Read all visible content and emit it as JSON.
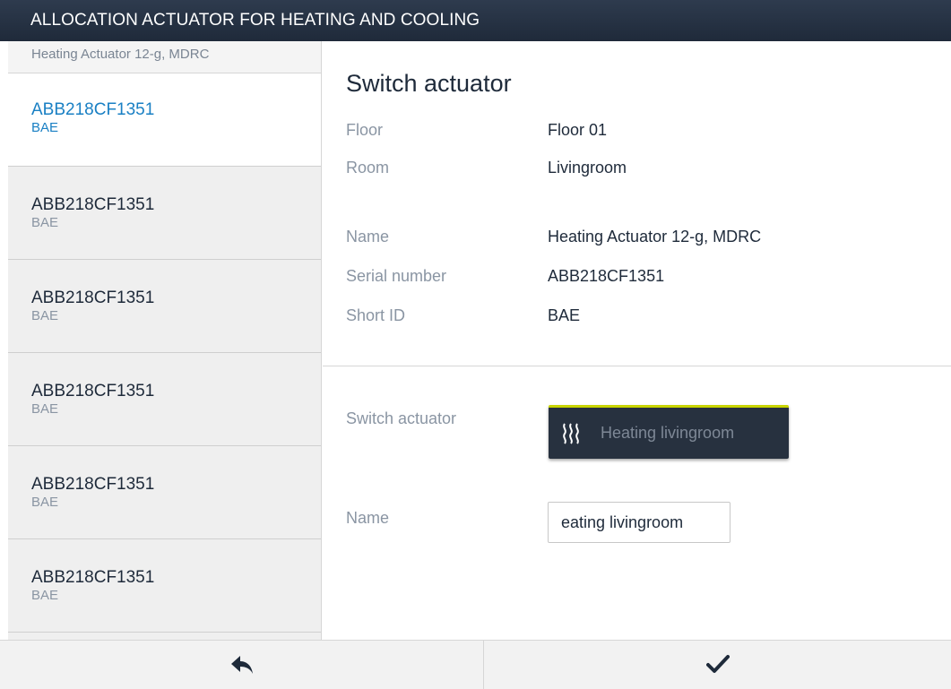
{
  "header": {
    "title": "ALLOCATION ACTUATOR FOR HEATING AND COOLING"
  },
  "sidebar": {
    "title": "Heating Actuator 12-g, MDRC",
    "items": [
      {
        "serial": "ABB218CF1351",
        "short_id": "BAE",
        "active": true
      },
      {
        "serial": "ABB218CF1351",
        "short_id": "BAE",
        "active": false
      },
      {
        "serial": "ABB218CF1351",
        "short_id": "BAE",
        "active": false
      },
      {
        "serial": "ABB218CF1351",
        "short_id": "BAE",
        "active": false
      },
      {
        "serial": "ABB218CF1351",
        "short_id": "BAE",
        "active": false
      },
      {
        "serial": "ABB218CF1351",
        "short_id": "BAE",
        "active": false
      }
    ],
    "active_color": "#1a80c4"
  },
  "main": {
    "title": "Switch actuator",
    "details": [
      {
        "label": "Floor",
        "value": "Floor 01"
      },
      {
        "label": "Room",
        "value": "Livingroom"
      },
      {
        "label": "Name",
        "value": "Heating Actuator 12-g, MDRC"
      },
      {
        "label": "Serial number",
        "value": "ABB218CF1351"
      },
      {
        "label": "Short ID",
        "value": "BAE"
      }
    ],
    "switch_actuator_label": "Switch actuator",
    "switch_button": {
      "label": "Heating livingroom",
      "icon": "heating-icon",
      "accent": "#c8d400"
    },
    "name_label": "Name",
    "name_value": "eating livingroom"
  },
  "footer": {
    "back_icon": "back-arrow-icon",
    "confirm_icon": "checkmark-icon"
  }
}
